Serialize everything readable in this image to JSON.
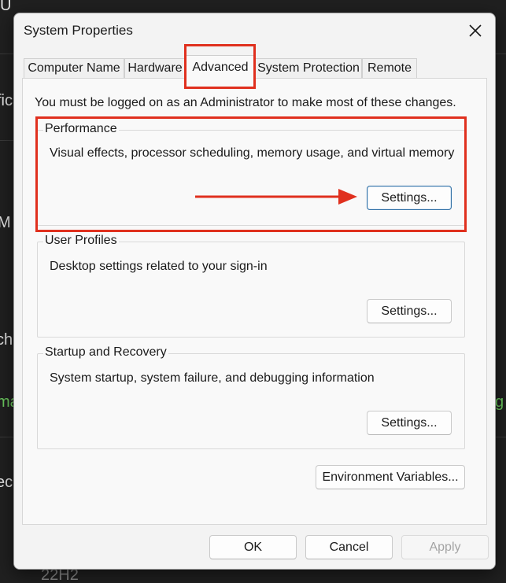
{
  "background": {
    "fragments": [
      "U",
      "fica",
      "M",
      "ch",
      "ma",
      "ecif",
      "g",
      "22H2"
    ]
  },
  "dialog": {
    "title": "System Properties",
    "tabs": [
      {
        "label": "Computer Name"
      },
      {
        "label": "Hardware"
      },
      {
        "label": "Advanced"
      },
      {
        "label": "System Protection"
      },
      {
        "label": "Remote"
      }
    ],
    "admin_note": "You must be logged on as an Administrator to make most of these changes.",
    "performance": {
      "title": "Performance",
      "description": "Visual effects, processor scheduling, memory usage, and virtual memory",
      "settings_label": "Settings..."
    },
    "user_profiles": {
      "title": "User Profiles",
      "description": "Desktop settings related to your sign-in",
      "settings_label": "Settings..."
    },
    "startup_recovery": {
      "title": "Startup and Recovery",
      "description": "System startup, system failure, and debugging information",
      "settings_label": "Settings..."
    },
    "env_vars_label": "Environment Variables...",
    "footer": {
      "ok_label": "OK",
      "cancel_label": "Cancel",
      "apply_label": "Apply"
    }
  },
  "colors": {
    "annotation_red": "#e0301e",
    "focus_blue": "#2f6fa5",
    "background_green": "#6ccb5f"
  }
}
